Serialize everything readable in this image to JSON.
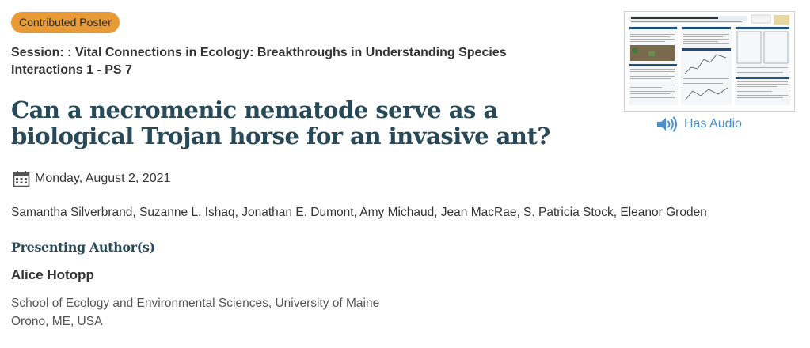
{
  "badge": {
    "label": "Contributed Poster",
    "color": "#e89a36"
  },
  "session": {
    "text": "Session: : Vital Connections in Ecology: Breakthroughs in Understanding Species Interactions 1 - PS 7"
  },
  "title": {
    "text": "Can a necromenic nematode serve as a biological Trojan horse for an invasive ant?"
  },
  "date": {
    "icon": "calendar-icon",
    "text": "Monday, August 2, 2021"
  },
  "authors": {
    "text": "Samantha Silverbrand, Suzanne L. Ishaq, Jonathan E. Dumont, Amy Michaud, Jean MacRae, S. Patricia Stock, Eleanor Groden"
  },
  "presenting": {
    "heading": "Presenting Author(s)",
    "name": "Alice Hotopp",
    "affiliation_line1": "School of Ecology and Environmental Sciences, University of Maine",
    "affiliation_line2": "Orono, ME, USA"
  },
  "poster": {
    "icon": "poster-thumbnail"
  },
  "audio": {
    "label": "Has Audio",
    "icon": "speaker-icon",
    "color": "#4a90c8"
  },
  "colors": {
    "title": "#284a58",
    "text": "#333333",
    "muted": "#555555"
  }
}
